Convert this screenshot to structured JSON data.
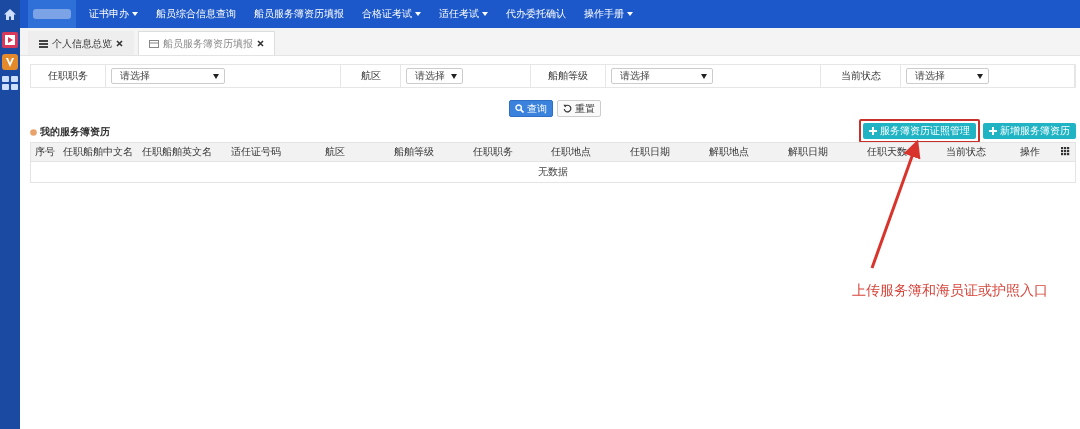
{
  "nav": {
    "items": [
      {
        "label": "证书申办",
        "dropdown": true
      },
      {
        "label": "船员综合信息查询",
        "dropdown": false
      },
      {
        "label": "船员服务簿资历填报",
        "dropdown": false
      },
      {
        "label": "合格证考试",
        "dropdown": true
      },
      {
        "label": "适任考试",
        "dropdown": true
      },
      {
        "label": "代办委托确认",
        "dropdown": false
      },
      {
        "label": "操作手册",
        "dropdown": true
      }
    ]
  },
  "tabs": [
    {
      "label": "个人信息总览",
      "selected": false
    },
    {
      "label": "船员服务簿资历填报",
      "selected": true
    }
  ],
  "filters": [
    {
      "label": "任职职务",
      "value": "请选择"
    },
    {
      "label": "航区",
      "value": "请选择"
    },
    {
      "label": "船舶等级",
      "value": "请选择"
    },
    {
      "label": "当前状态",
      "value": "请选择"
    }
  ],
  "buttons": [
    {
      "label": "查询",
      "kind": "primary"
    },
    {
      "label": "重置",
      "kind": "default"
    }
  ],
  "section_title": "我的服务簿资历",
  "actions": [
    {
      "label": "服务簿资历证照管理",
      "highlighted": true
    },
    {
      "label": "新增服务簿资历",
      "highlighted": false
    }
  ],
  "table": {
    "columns": [
      "序号",
      "任职船舶中文名",
      "任职船舶英文名",
      "适任证号码",
      "航区",
      "船舶等级",
      "任职职务",
      "任职地点",
      "任职日期",
      "解职地点",
      "解职日期",
      "任职天数",
      "当前状态",
      "操作"
    ],
    "empty_text": "无数据"
  },
  "annotation": {
    "text": "上传服务簿和海员证或护照入口"
  }
}
